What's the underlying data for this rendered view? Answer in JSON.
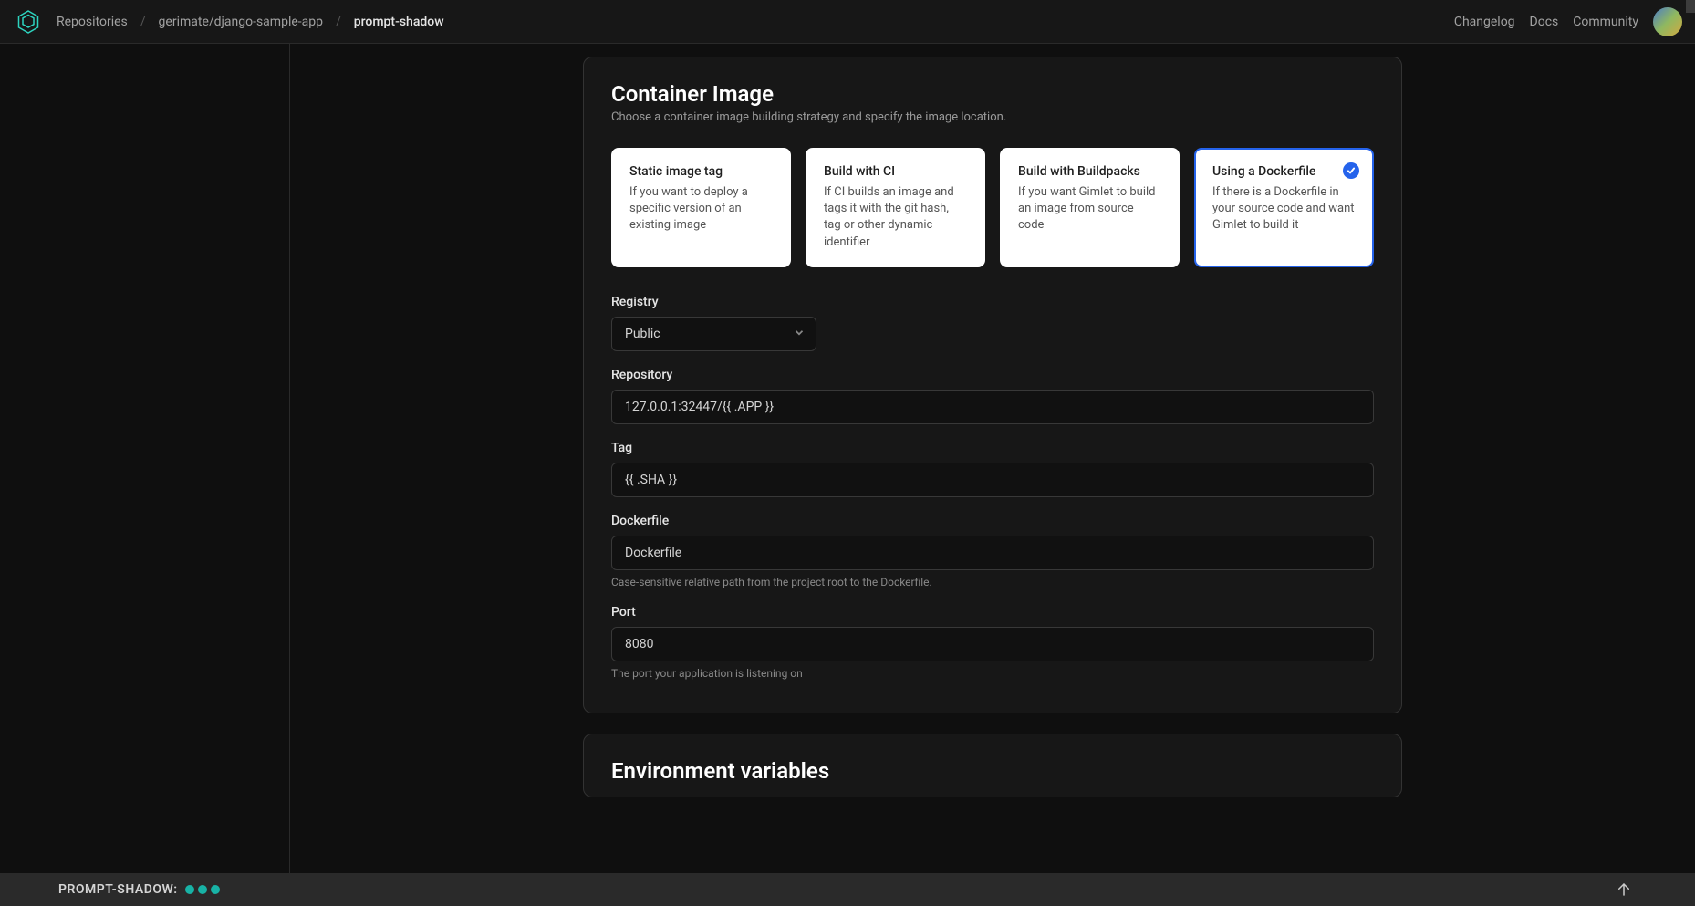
{
  "header": {
    "breadcrumbs": {
      "root": "Repositories",
      "repo": "gerimate/django-sample-app",
      "page": "prompt-shadow"
    },
    "nav": {
      "changelog": "Changelog",
      "docs": "Docs",
      "community": "Community"
    }
  },
  "containerImage": {
    "title": "Container Image",
    "subtitle": "Choose a container image building strategy and specify the image location.",
    "strategies": [
      {
        "title": "Static image tag",
        "desc": "If you want to deploy a specific version of an existing image"
      },
      {
        "title": "Build with CI",
        "desc": "If CI builds an image and tags it with the git hash, tag or other dynamic identifier"
      },
      {
        "title": "Build with Buildpacks",
        "desc": "If you want Gimlet to build an image from source code"
      },
      {
        "title": "Using a Dockerfile",
        "desc": "If there is a Dockerfile in your source code and want Gimlet to build it"
      }
    ],
    "fields": {
      "registry": {
        "label": "Registry",
        "value": "Public"
      },
      "repository": {
        "label": "Repository",
        "value": "127.0.0.1:32447/{{ .APP }}"
      },
      "tag": {
        "label": "Tag",
        "value": "{{ .SHA }}"
      },
      "dockerfile": {
        "label": "Dockerfile",
        "value": "Dockerfile",
        "help": "Case-sensitive relative path from the project root to the Dockerfile."
      },
      "port": {
        "label": "Port",
        "value": "8080",
        "help": "The port your application is listening on"
      }
    }
  },
  "envVars": {
    "title": "Environment variables"
  },
  "status": {
    "label": "PROMPT-SHADOW:"
  }
}
